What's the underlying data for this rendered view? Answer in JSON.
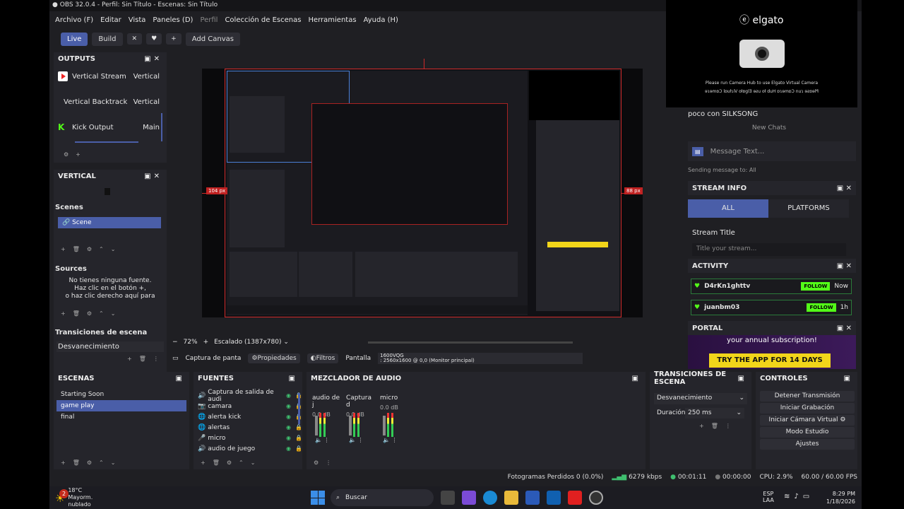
{
  "window": {
    "title": "OBS 32.0.4 - Perfil: Sin Título - Escenas: Sin Título"
  },
  "menu": [
    "Archivo (F)",
    "Editar",
    "Vista",
    "Paneles (D)",
    "Perfil",
    "Colección de Escenas",
    "Herramientas",
    "Ayuda (H)"
  ],
  "toolbar": {
    "live": "Live",
    "build": "Build",
    "add_canvas": "Add Canvas",
    "icons": [
      "✕",
      "♥",
      "+"
    ]
  },
  "outputs": {
    "title": "OUTPUTS",
    "items": [
      {
        "name": "Vertical Stream",
        "tag": "Vertical",
        "icon": "youtube-icon"
      },
      {
        "name": "Vertical Backtrack",
        "tag": "Vertical",
        "icon": ""
      },
      {
        "name": "Kick Output",
        "tag": "Main",
        "icon": "kick-icon"
      }
    ]
  },
  "vertical": {
    "title": "VERTICAL"
  },
  "scenes_small": {
    "title": "Scenes",
    "items": [
      "Scene"
    ]
  },
  "sources_small": {
    "title": "Sources",
    "empty_1": "No tienes ninguna fuente.",
    "empty_2": "Haz clic en el botón +,",
    "empty_3": "o haz clic derecho aquí para"
  },
  "transitions_small": {
    "title": "Transiciones de escena",
    "value": "Desvanecimiento"
  },
  "preview": {
    "zoom": "72%",
    "scaled": "Escalado (1387x780)",
    "left_px": "104 px",
    "right_px": "88 px"
  },
  "context_bar": {
    "capture": "Captura de panta",
    "properties": "Propiedades",
    "filters": "Filtros",
    "screen": "Pantalla",
    "monitor_1": "1600VQG",
    "monitor_2": ": 2560x1600 @ 0,0 (Monitor principal)"
  },
  "escenas": {
    "title": "ESCENAS",
    "items": [
      "Starting Soon",
      "game play",
      "final"
    ],
    "selected": 1
  },
  "fuentes": {
    "title": "FUENTES",
    "items": [
      {
        "icon": "🔊",
        "name": "Captura de salida de audi"
      },
      {
        "icon": "📷",
        "name": "camara"
      },
      {
        "icon": "🌐",
        "name": "alerta kick"
      },
      {
        "icon": "🌐",
        "name": "alertas"
      },
      {
        "icon": "🎤",
        "name": "micro"
      },
      {
        "icon": "🔊",
        "name": "audio de juego"
      }
    ]
  },
  "mixer": {
    "title": "MEZCLADOR DE AUDIO",
    "channels": [
      {
        "name": "audio de j",
        "db": "0.0 dB"
      },
      {
        "name": "Captura d",
        "db": "0.0 dB"
      },
      {
        "name": "micro",
        "db": "0.0 dB"
      }
    ]
  },
  "transitions": {
    "title": "TRANSICIONES DE ESCENA",
    "value": "Desvanecimiento",
    "duration_label": "Duración",
    "duration": "250 ms"
  },
  "controls": {
    "title": "CONTROLES",
    "buttons": [
      "Detener Transmisión",
      "Iniciar Grabación",
      "Iniciar Cámara Virtual",
      "Modo Estudio",
      "Ajustes"
    ]
  },
  "status": {
    "dropped": "Fotogramas Perdidos 0 (0.0%)",
    "kbps": "6279 kbps",
    "stream_time": "00:01:11",
    "rec_time": "00:00:00",
    "cpu": "CPU: 2.9%",
    "fps": "60.00 / 60.00 FPS"
  },
  "elgato": {
    "brand": "elgato",
    "msg_1": "Please run Camera Hub to use Elgato Virtual Camera",
    "msg_2": "ɘɿɘmɒƆ lɒuƚɿiV oƚɒglƎ ɘƨu oƚ duH ɒɿɘmɒƆ nuɿ ɘƨɒɘlꟼ"
  },
  "chat": {
    "title_line": "poco con SILKSONG",
    "new_chats": "New Chats",
    "placeholder": "Message Text...",
    "sending_to": "Sending message to: All"
  },
  "stream_info": {
    "title": "STREAM INFO",
    "tab_all": "ALL",
    "tab_platforms": "PLATFORMS",
    "field_label": "Stream Title",
    "field_placeholder": "Title your stream..."
  },
  "activity": {
    "title": "ACTIVITY",
    "items": [
      {
        "user": "D4rKn1ghttv",
        "action": "FOLLOW",
        "time": "Now"
      },
      {
        "user": "juanbm03",
        "action": "FOLLOW",
        "time": "1h"
      }
    ]
  },
  "portal": {
    "title": "PORTAL",
    "text": "your annual subscription!",
    "cta": "TRY THE APP FOR 14 DAYS"
  },
  "taskbar": {
    "temp": "18°C",
    "weather": "Mayorm. nublado",
    "search": "Buscar",
    "lang_1": "ESP",
    "lang_2": "LAA",
    "time": "8:29 PM",
    "date": "1/18/2026",
    "badge": "2"
  },
  "colors": {
    "accent": "#4a5ea8",
    "preview_border": "#d02a2a",
    "kick_green": "#53fc18",
    "portal_yellow": "#f2d51a"
  }
}
